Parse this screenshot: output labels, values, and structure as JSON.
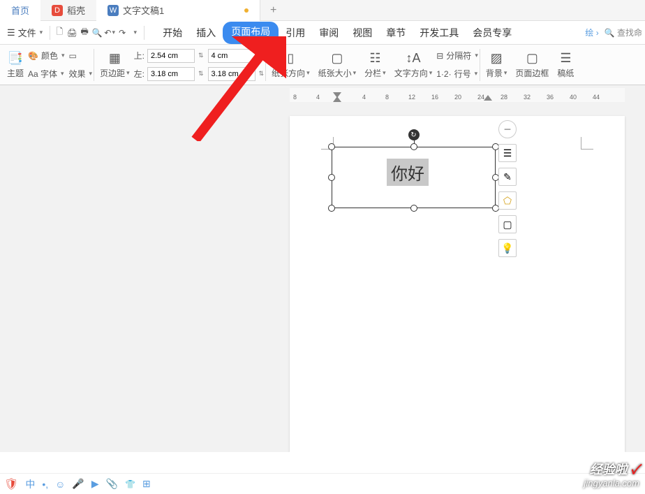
{
  "tabs": {
    "home": "首页",
    "dao": "稻壳",
    "doc": "文字文稿1",
    "add": "+"
  },
  "file_menu": "文件",
  "menu_tabs": [
    "开始",
    "插入",
    "页面布局",
    "引用",
    "审阅",
    "视图",
    "章节",
    "开发工具",
    "会员专享"
  ],
  "active_tab_index": 2,
  "right_menu": {
    "ink": "绘",
    "search": "查找命"
  },
  "ribbon": {
    "theme": "主题",
    "font": "Aa 字体",
    "color": "颜色",
    "effect": "效果",
    "margin": "页边距",
    "top": "上:",
    "left": "左:",
    "top_val": "2.54 cm",
    "left_val": "3.18 cm",
    "right_val1": "4 cm",
    "right_val2": "3.18 cm",
    "orient": "纸张方向",
    "size": "纸张大小",
    "columns": "分栏",
    "textdir": "文字方向",
    "lineno": "行号",
    "break": "分隔符",
    "bg": "背景",
    "border": "页面边框",
    "paper": "稿纸"
  },
  "ruler_ticks": [
    "8",
    "4",
    "",
    "4",
    "8",
    "12",
    "16",
    "20",
    "24",
    "28",
    "32",
    "36",
    "40",
    "44"
  ],
  "textbox_text": "你好",
  "status": {
    "lang": "中"
  },
  "watermark": {
    "title": "经验啦",
    "url": "jingyanla.com"
  }
}
